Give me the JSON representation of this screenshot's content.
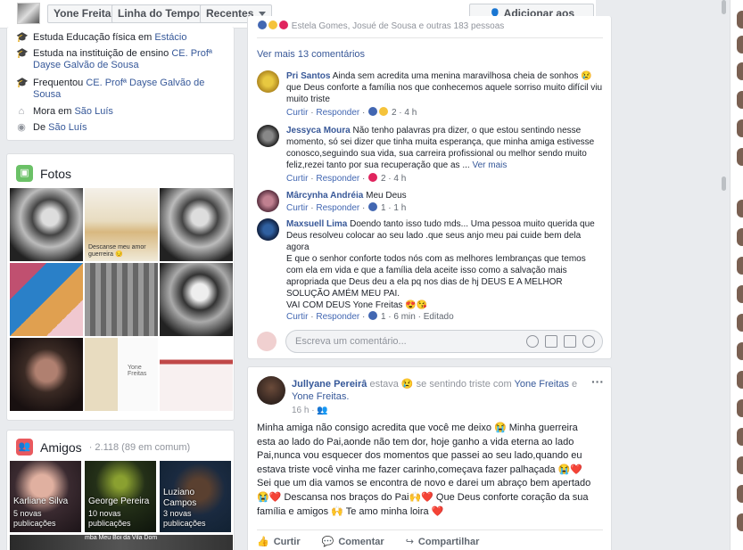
{
  "topbar": {
    "name_btn": "Yone Freitas",
    "timeline_btn": "Linha do Tempo",
    "recent_btn": "Recentes",
    "add_friend": "Adicionar aos amigos"
  },
  "intro": {
    "rows": [
      {
        "pre": "Estuda Educação física em ",
        "link": "Estácio",
        "post": "",
        "icon": "graduation-cap-icon"
      },
      {
        "pre": "Estuda na instituição de ensino ",
        "link": "CE. Profª Dayse Galvão de Sousa",
        "post": "",
        "icon": "graduation-cap-icon"
      },
      {
        "pre": "Frequentou ",
        "link": "CE. Profª Dayse Galvão de Sousa",
        "post": "",
        "icon": "graduation-cap-icon"
      },
      {
        "pre": "Mora em ",
        "link": "São Luís",
        "post": "",
        "icon": "home-icon"
      },
      {
        "pre": "De ",
        "link": "São Luís",
        "post": "",
        "icon": "location-pin-icon"
      }
    ]
  },
  "photos": {
    "title": "Fotos",
    "caption_2": "Descanse meu amor guerreira 😔",
    "caption_collage": "Yone Freitas"
  },
  "friends": {
    "title": "Amigos",
    "count": "· 2.118 (89 em comum)",
    "tiles": [
      {
        "name": "Karliane Silva",
        "sub1": "5 novas",
        "sub2": "publicações"
      },
      {
        "name": "George Pereira",
        "sub1": "10 novas",
        "sub2": "publicações"
      },
      {
        "name": "Luziano",
        "name2": "Campos",
        "sub1": "3 novas",
        "sub2": "publicações"
      }
    ],
    "strip_text": "mba Meu Boi da Vila Dom"
  },
  "post1": {
    "header_partial": "Estela Gomes, Josué de Sousa e outras 183 pessoas",
    "more_comments": "Ver mais 13 comentários",
    "comments": [
      {
        "author": "Pri Santos",
        "text": "Ainda sem acredita uma menina maravilhosa cheia de sonhos 😢 que Deus conforte a família nos que conhecemos aquele sorriso muito difícil viu muito triste",
        "like": "Curtir",
        "reply": "Responder",
        "count": "2",
        "time": "4 h",
        "see_more": ""
      },
      {
        "author": "Jessyca Moura",
        "text": "Não tenho palavras pra dizer, o que estou sentindo nesse momento, só sei dizer que tinha muita esperança, que minha amiga estivesse conosco,seguindo sua vida, sua carreira profissional ou melhor sendo muito feliz,rezei tanto por sua recuperação que as ...",
        "like": "Curtir",
        "reply": "Responder",
        "count": "2",
        "time": "4 h",
        "see_more": "Ver mais"
      },
      {
        "author": "Mârcynha Andréia",
        "text": "Meu Deus",
        "like": "Curtir",
        "reply": "Responder",
        "count": "1",
        "time": "1 h",
        "see_more": ""
      },
      {
        "author": "Maxsuell Lima",
        "text": "Doendo tanto isso tudo mds... Uma pessoa muito querida que Deus resolveu colocar ao seu lado .que seus anjo meu pai cuide bem dela agora",
        "text2": "E que o senhor conforte todos nós com as melhores lembranças que temos com ela em vida e que a família dela aceite isso como a salvação mais apropriada que Deus deu a ela pq nos dias de hj DEUS E A MELHOR SOLUÇÃO AMÉM MEU PAI.",
        "text3": "VAI COM DEUS Yone Freitas 😍😘",
        "like": "Curtir",
        "reply": "Responder",
        "count": "1",
        "time": "6 min",
        "edited": "Editado"
      }
    ],
    "write_placeholder": "Escreva um comentário..."
  },
  "post2": {
    "author": "Jullyane Pereirâ",
    "status_pre": "estava 😢 se sentindo triste com",
    "tag1": "Yone Freitas",
    "and": "e",
    "tag2": "Yone Freitas.",
    "time": "16 h ·",
    "text": "Minha amiga não consigo acredita que você me deixo 😭 Minha guerreira esta ao lado do Pai,aonde não tem dor, hoje ganho a vida eterna ao lado Pai,nunca vou esquecer dos momentos que passei ao seu lado,quando eu estava triste você vinha me fazer carinho,começava fazer palhaçada 😭❤️ Sei que um dia vamos se encontra de novo e darei um abraço bem apertado 😭❤️ Descansa nos braços do Pai🙌❤️ Que Deus conforte coração da sua família e amigos 🙌 Te amo minha loira ❤️",
    "like": "Curtir",
    "comment": "Comentar",
    "share": "Compartilhar"
  },
  "colors": {
    "link": "#365899",
    "like_blue": "#4267b2",
    "bg": "#e9ebee"
  }
}
